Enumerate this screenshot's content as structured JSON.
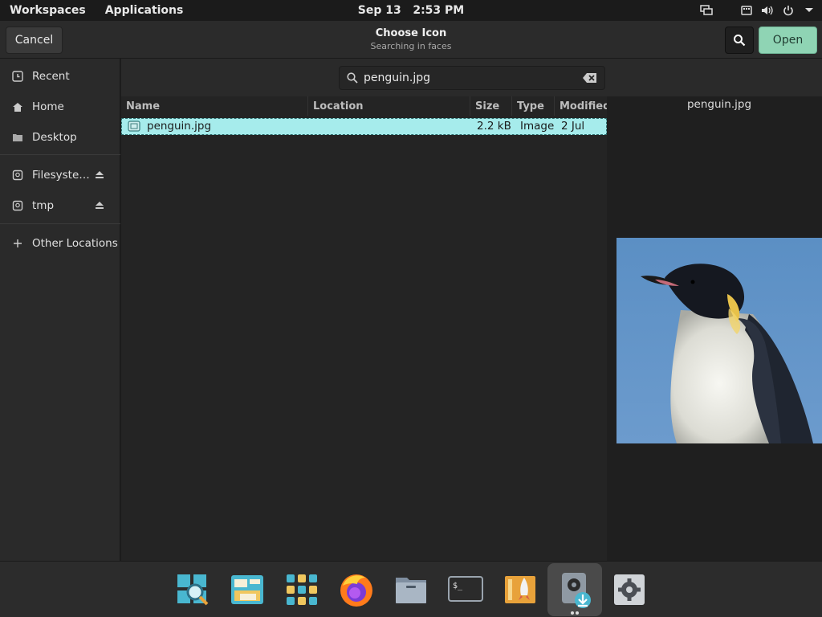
{
  "topbar": {
    "workspaces": "Workspaces",
    "applications": "Applications",
    "date": "Sep 13",
    "time": "2:53 PM"
  },
  "dialog": {
    "title": "Choose Icon",
    "subtitle": "Searching in faces",
    "cancel_label": "Cancel",
    "open_label": "Open",
    "accent": "#8fd4b4"
  },
  "sidebar": {
    "items": [
      {
        "label": "Recent",
        "icon": "clock-icon"
      },
      {
        "label": "Home",
        "icon": "home-icon"
      },
      {
        "label": "Desktop",
        "icon": "folder-icon"
      },
      {
        "label": "Filesyste…",
        "icon": "drive-icon",
        "eject": true
      },
      {
        "label": "tmp",
        "icon": "drive-icon",
        "eject": true
      },
      {
        "label": "Other Locations",
        "icon": "plus-icon"
      }
    ]
  },
  "search": {
    "value": "penguin.jpg"
  },
  "filelist": {
    "columns": [
      "Name",
      "Location",
      "Size",
      "Type",
      "Modified"
    ],
    "rows": [
      {
        "name": "penguin.jpg",
        "location": "",
        "size": "2.2 kB",
        "type": "Image",
        "modified": "2 Jul",
        "selected": true
      }
    ],
    "selection_color": "#a6ecec"
  },
  "preview": {
    "filename": "penguin.jpg"
  },
  "dock": {
    "items": [
      "search-app-icon",
      "screenshot-app-icon",
      "app-grid-icon",
      "firefox-icon",
      "files-icon",
      "terminal-icon",
      "launcher-icon",
      "disk-install-icon",
      "settings-icon"
    ]
  }
}
